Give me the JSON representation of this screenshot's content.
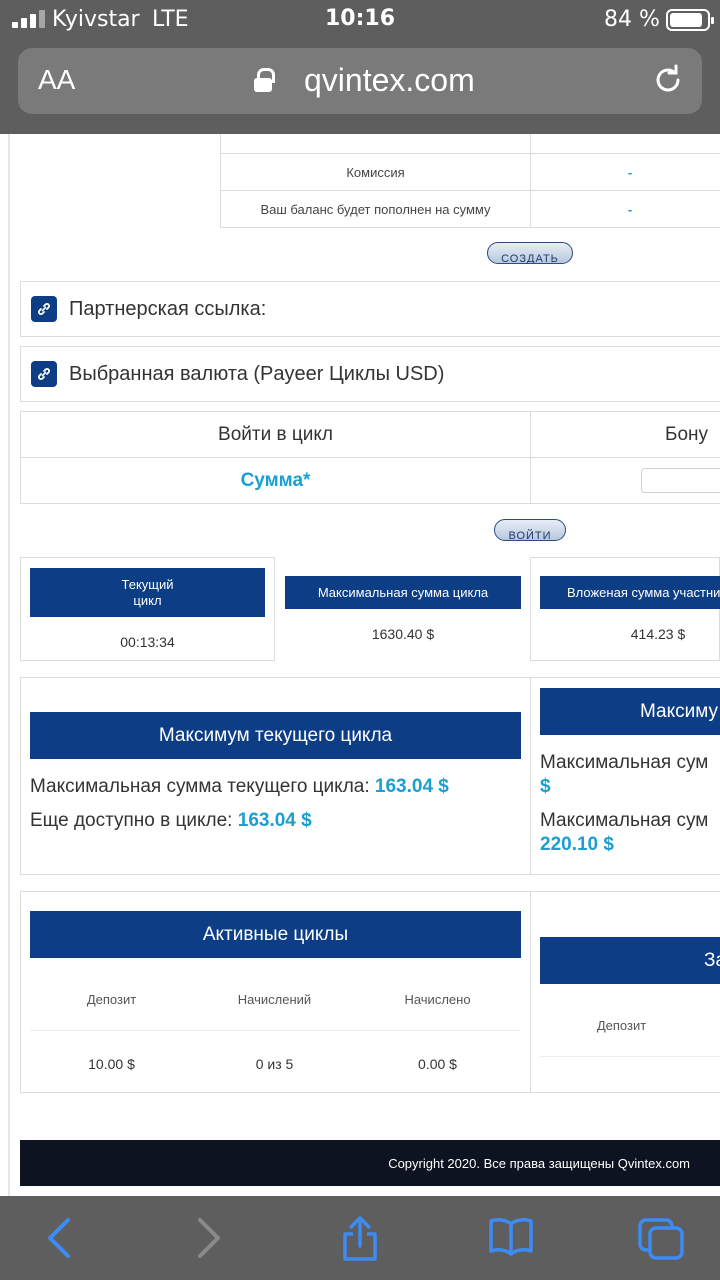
{
  "status_bar": {
    "carrier": "Kyivstar",
    "network": "LTE",
    "time": "10:16",
    "battery": "84 %"
  },
  "address_bar": {
    "text_size": "AA",
    "url": "qvintex.com"
  },
  "deposit_form": {
    "commission_label": "Комиссия",
    "commission_value": "-",
    "balance_label": "Ваш баланс будет пополнен на сумму",
    "balance_value": "-",
    "create_button": "СОЗДАТЬ"
  },
  "partner_link": {
    "label": "Партнерская ссылка:"
  },
  "currency": {
    "label": "Выбранная валюта (Payeer Циклы USD)"
  },
  "cycle_entry": {
    "enter_header": "Войти в цикл",
    "bonus_header": "Бону",
    "amount_label": "Сумма*",
    "enter_button": "ВОЙТИ"
  },
  "cycle_stats": {
    "current_cycle_label": "Текущий цикл",
    "current_cycle_value": "00:13:34",
    "max_sum_label": "Максимальная сумма цикла",
    "max_sum_value": "1630.40 $",
    "invested_label": "Вложеная сумма участни",
    "invested_value": "414.23 $"
  },
  "max_current": {
    "title": "Максимум текущего цикла",
    "max_label": "Максимальная сумма текущего цикла:",
    "max_value": "163.04 $",
    "avail_label": "Еще доступно в цикле:",
    "avail_value": "163.04 $"
  },
  "max_right": {
    "title": "Максиму",
    "line1_label": "Максимальная сум",
    "line1_value": "$",
    "line2_label": "Максимальная сум",
    "line2_value": "220.10 $"
  },
  "active_cycles": {
    "title": "Активные циклы",
    "columns": [
      "Депозит",
      "Начислений",
      "Начислено"
    ],
    "row": [
      "10.00 $",
      "0 из 5",
      "0.00 $"
    ]
  },
  "completed_cycles": {
    "title": "За",
    "column": "Депозит"
  },
  "footer": {
    "copyright": "Copyright 2020. Все права защищены Qvintex.com"
  },
  "colors": {
    "navy": "#0d3e85",
    "accent": "#1a9fd1"
  }
}
